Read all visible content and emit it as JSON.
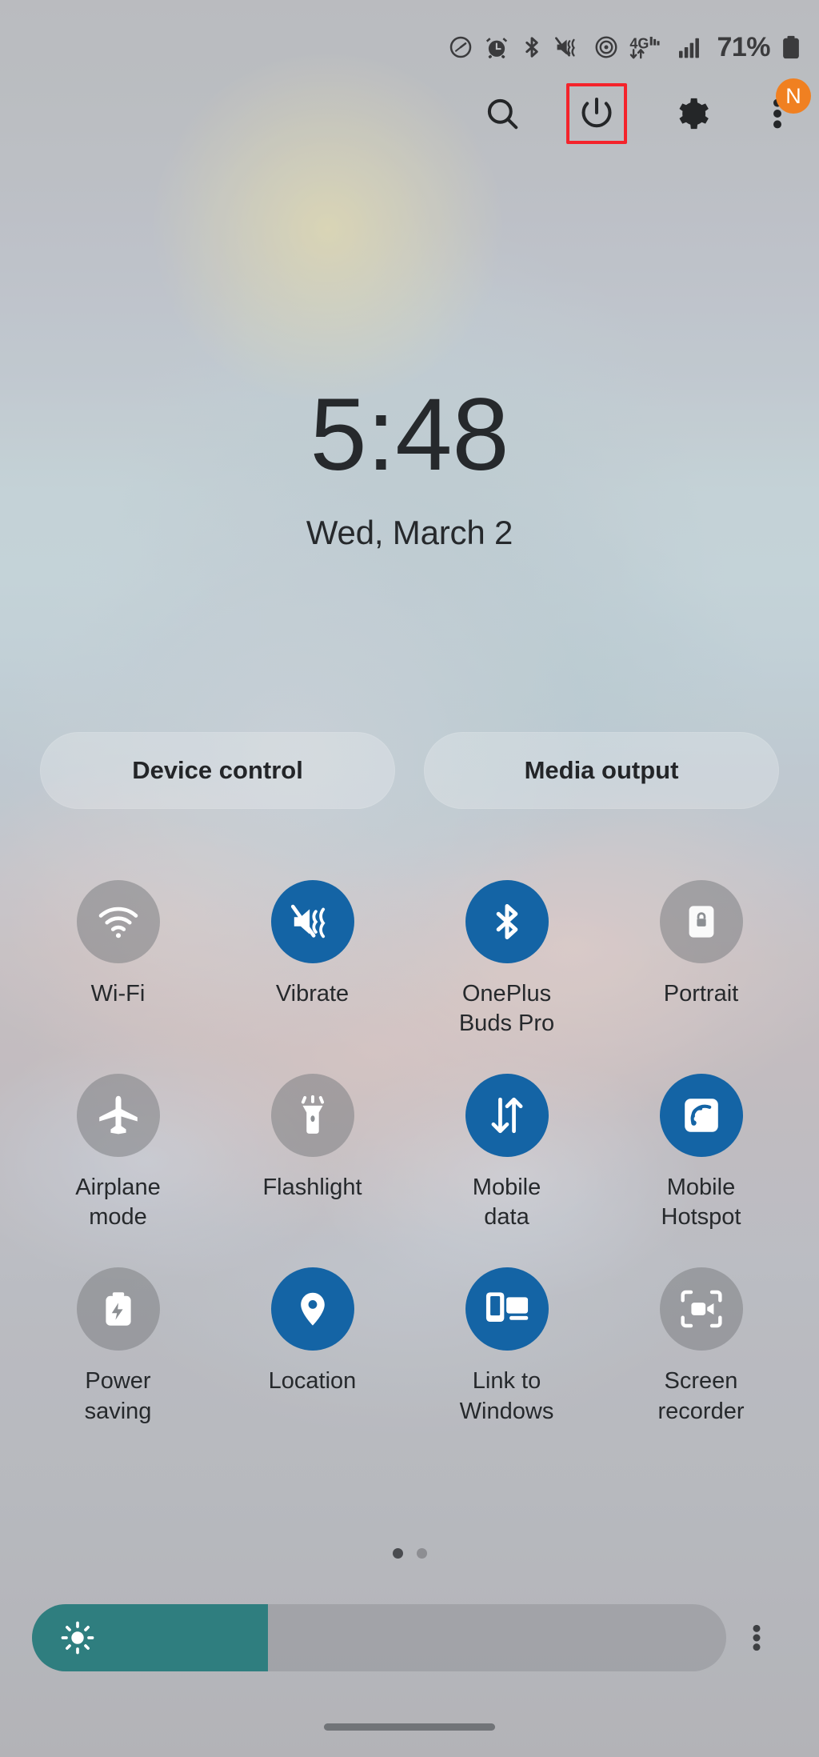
{
  "status_bar": {
    "icons": [
      {
        "name": "data-saver-icon",
        "glyph": "speedometer"
      },
      {
        "name": "alarm-icon",
        "glyph": "alarm"
      },
      {
        "name": "bluetooth-icon",
        "glyph": "bluetooth"
      },
      {
        "name": "sound-vibrate-mute-icon",
        "glyph": "mute-vibrate"
      },
      {
        "name": "hotspot-icon",
        "glyph": "hotspot"
      },
      {
        "name": "network-type-icon",
        "glyph": "4g-lte"
      },
      {
        "name": "signal-strength-icon",
        "glyph": "signal-bars"
      }
    ],
    "network_label": "4G",
    "battery_percent": "71%"
  },
  "header": {
    "search_label": "Search",
    "power_label": "Power",
    "settings_label": "Settings",
    "menu_label": "More options",
    "menu_badge": "N",
    "highlight_color": "#f4232b",
    "badge_color": "#f08021"
  },
  "clock": {
    "time": "5:48",
    "date": "Wed, March 2"
  },
  "pills": [
    {
      "label": "Device control"
    },
    {
      "label": "Media output"
    }
  ],
  "tiles": [
    {
      "label": "Wi-Fi",
      "icon": "wifi-icon",
      "state": "off"
    },
    {
      "label": "Vibrate",
      "icon": "vibrate-icon",
      "state": "on"
    },
    {
      "label": "OnePlus\nBuds Pro",
      "icon": "bluetooth-icon",
      "state": "on"
    },
    {
      "label": "Portrait",
      "icon": "auto-rotate-lock-icon",
      "state": "off"
    },
    {
      "label": "Airplane\nmode",
      "icon": "airplane-icon",
      "state": "off"
    },
    {
      "label": "Flashlight",
      "icon": "flashlight-icon",
      "state": "off"
    },
    {
      "label": "Mobile\ndata",
      "icon": "mobile-data-icon",
      "state": "on"
    },
    {
      "label": "Mobile\nHotspot",
      "icon": "hotspot-icon",
      "state": "on"
    },
    {
      "label": "Power\nsaving",
      "icon": "power-saving-icon",
      "state": "off"
    },
    {
      "label": "Location",
      "icon": "location-pin-icon",
      "state": "on"
    },
    {
      "label": "Link to\nWindows",
      "icon": "link-to-windows-icon",
      "state": "on"
    },
    {
      "label": "Screen\nrecorder",
      "icon": "screen-recorder-icon",
      "state": "off"
    }
  ],
  "pagination": {
    "pages": 2,
    "active_index": 0
  },
  "brightness": {
    "label": "Brightness",
    "value_percent": 34,
    "fill_color": "#2f7e7f",
    "more_label": "Brightness options"
  },
  "nav": {
    "handle_label": "Home gesture handle"
  }
}
